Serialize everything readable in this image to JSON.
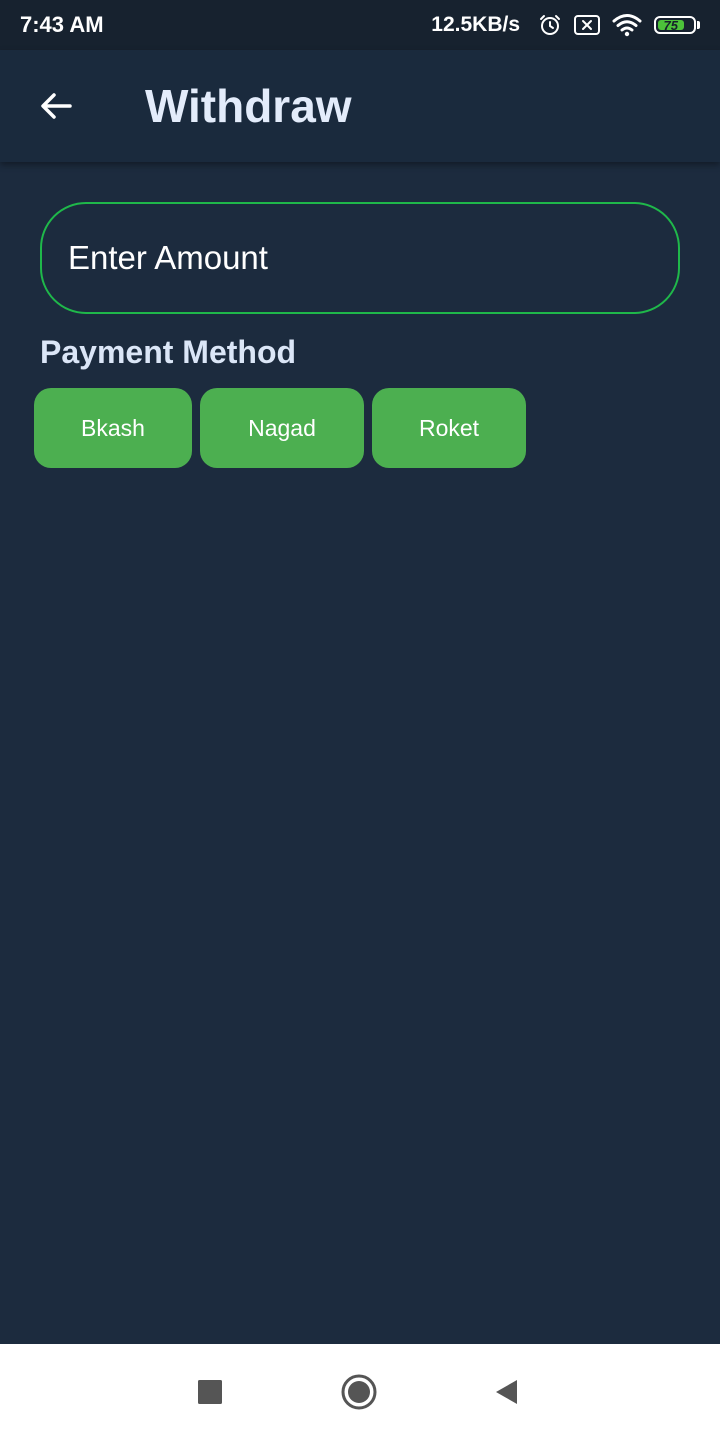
{
  "status_bar": {
    "time": "7:43 AM",
    "net_speed": "12.5KB/s",
    "battery_level": "75",
    "icons": [
      "alarm-icon",
      "sim-off-icon",
      "wifi-icon",
      "battery-icon"
    ]
  },
  "app_bar": {
    "title": "Withdraw",
    "back_icon": "arrow-back-icon"
  },
  "amount_field": {
    "placeholder": "Enter Amount",
    "value": ""
  },
  "payment": {
    "label": "Payment Method",
    "methods": [
      {
        "label": "Bkash"
      },
      {
        "label": "Nagad"
      },
      {
        "label": "Roket"
      }
    ]
  },
  "colors": {
    "background": "#1c2b3e",
    "app_bar": "#1a2a3d",
    "accent_green": "#4caf50",
    "field_border": "#1fb84a",
    "title_text": "#e3ecfb"
  },
  "nav_bar": {
    "icons": [
      "recent-apps-icon",
      "home-icon",
      "back-icon"
    ]
  }
}
